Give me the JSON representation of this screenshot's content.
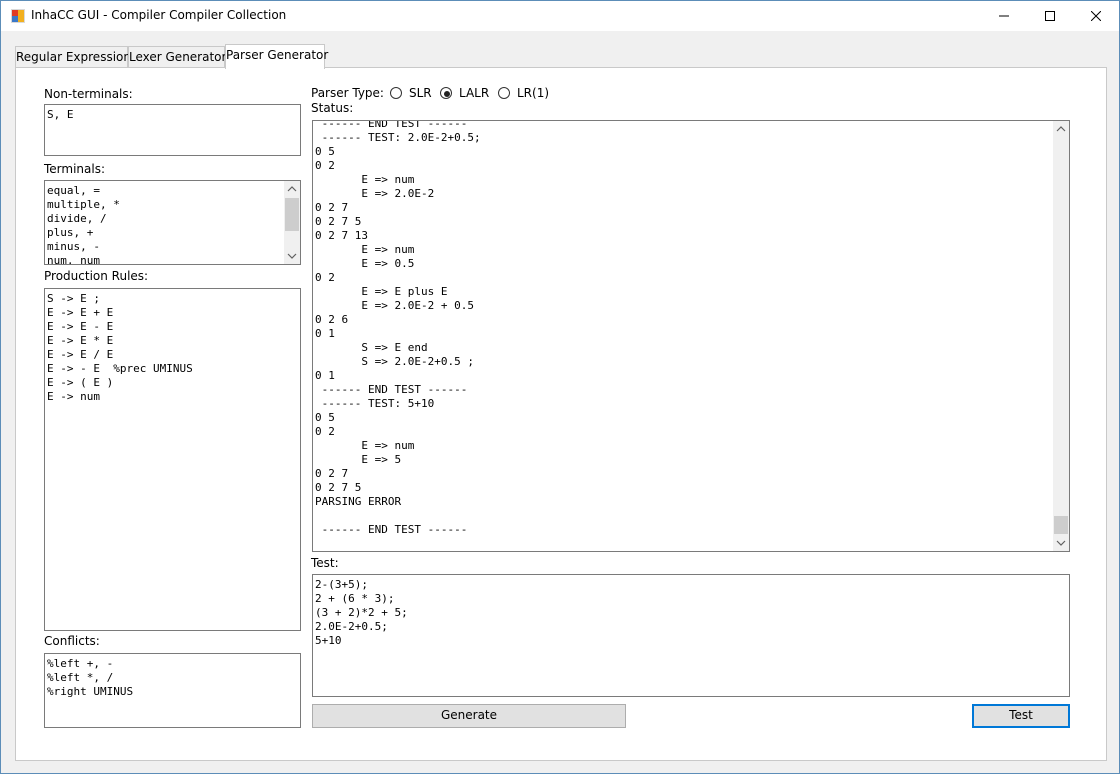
{
  "window": {
    "title": "InhaCC GUI - Compiler Compiler Collection",
    "icons": {
      "app": "app-icon",
      "minimize": "minimize-icon",
      "maximize": "maximize-icon",
      "close": "close-icon"
    }
  },
  "tabs": [
    "Regular Expression",
    "Lexer Generator",
    "Parser Generator"
  ],
  "active_tab": "Parser Generator",
  "labels": {
    "nonterminals": "Non-terminals:",
    "terminals": "Terminals:",
    "production_rules": "Production Rules:",
    "conflicts": "Conflicts:",
    "parser_type": "Parser Type:",
    "status": "Status:",
    "test": "Test:"
  },
  "nonterminals_text": "S, E",
  "terminals_text": "equal, =\nmultiple, *\ndivide, /\nplus, +\nminus, -\nnum, num",
  "production_rules_text": "S -> E ;\nE -> E + E\nE -> E - E\nE -> E * E\nE -> E / E\nE -> - E  %prec UMINUS\nE -> ( E )\nE -> num",
  "conflicts_text": "%left +, -\n%left *, /\n%right UMINUS",
  "parser_types": [
    {
      "label": "SLR",
      "selected": false
    },
    {
      "label": "LALR",
      "selected": true
    },
    {
      "label": "LR(1)",
      "selected": false
    }
  ],
  "status_text": " ------ END TEST ------\n ------ TEST: 2.0E-2+0.5;\n0 5\n0 2\n       E => num\n       E => 2.0E-2\n0 2 7\n0 2 7 5\n0 2 7 13\n       E => num\n       E => 0.5\n0 2\n       E => E plus E\n       E => 2.0E-2 + 0.5\n0 2 6\n0 1\n       S => E end\n       S => 2.0E-2+0.5 ;\n0 1\n ------ END TEST ------\n ------ TEST: 5+10\n0 5\n0 2\n       E => num\n       E => 5\n0 2 7\n0 2 7 5\nPARSING ERROR\n\n ------ END TEST ------",
  "test_text": "2-(3+5);\n2 + (6 * 3);\n(3 + 2)*2 + 5;\n2.0E-2+0.5;\n5+10",
  "buttons": {
    "generate": "Generate",
    "test": "Test"
  },
  "scroll": {
    "terminals_thumb_fraction": 0.44,
    "status_thumb_fraction": 0.95
  }
}
